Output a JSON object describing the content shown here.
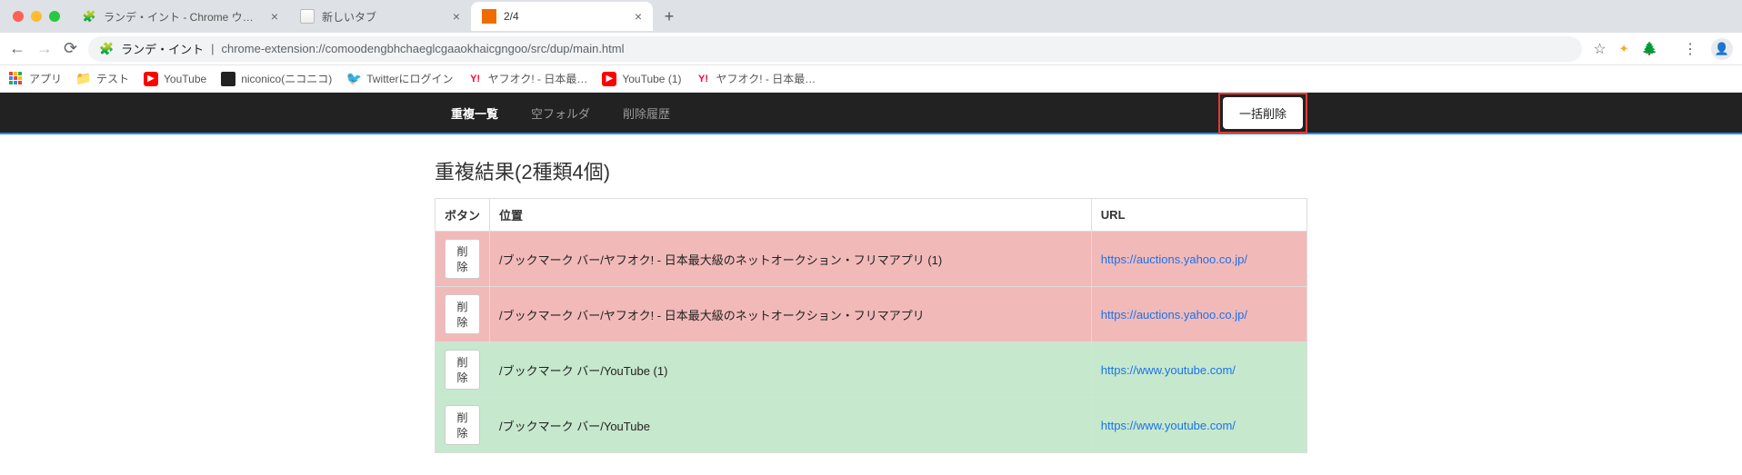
{
  "browser": {
    "tabs": [
      {
        "title": "ランデ・イント - Chrome ウェブ",
        "active": false,
        "favicon": "store"
      },
      {
        "title": "新しいタブ",
        "active": false,
        "favicon": "blank"
      },
      {
        "title": "2/4",
        "active": true,
        "favicon": "ext"
      }
    ],
    "nav": {
      "back": "←",
      "forward": "→",
      "reload": "⟳"
    },
    "omnibox": {
      "icon_label": "puzzle-icon",
      "site": "ランデ・イント",
      "sep": " | ",
      "path": "chrome-extension://comoodengbhchaeglcgaaokhaicgngoo/src/dup/main.html"
    },
    "bookmarks": [
      {
        "icon": "apps",
        "label": "アプリ"
      },
      {
        "icon": "folder",
        "label": "テスト"
      },
      {
        "icon": "youtube",
        "label": "YouTube"
      },
      {
        "icon": "nico",
        "label": "niconico(ニコニコ)"
      },
      {
        "icon": "twitter",
        "label": "Twitterにログイン"
      },
      {
        "icon": "yahoo",
        "label": "ヤフオク! - 日本最…"
      },
      {
        "icon": "youtube",
        "label": "YouTube (1)"
      },
      {
        "icon": "yahoo",
        "label": "ヤフオク! - 日本最…"
      }
    ]
  },
  "ext": {
    "tabs": [
      {
        "label": "重複一覧",
        "active": true
      },
      {
        "label": "空フォルダ",
        "active": false
      },
      {
        "label": "削除履歴",
        "active": false
      }
    ],
    "bulk_delete": "一括削除"
  },
  "result": {
    "heading": "重複結果(2種類4個)",
    "columns": {
      "btn": "ボタン",
      "pos": "位置",
      "url": "URL"
    },
    "delete_label": "削除",
    "rows": [
      {
        "group": "red",
        "pos": "/ブックマーク バー/ヤフオク! - 日本最大級のネットオークション・フリマアプリ (1)",
        "url": "https://auctions.yahoo.co.jp/"
      },
      {
        "group": "red",
        "pos": "/ブックマーク バー/ヤフオク! - 日本最大級のネットオークション・フリマアプリ",
        "url": "https://auctions.yahoo.co.jp/"
      },
      {
        "group": "green",
        "pos": "/ブックマーク バー/YouTube (1)",
        "url": "https://www.youtube.com/"
      },
      {
        "group": "green",
        "pos": "/ブックマーク バー/YouTube",
        "url": "https://www.youtube.com/"
      }
    ]
  }
}
